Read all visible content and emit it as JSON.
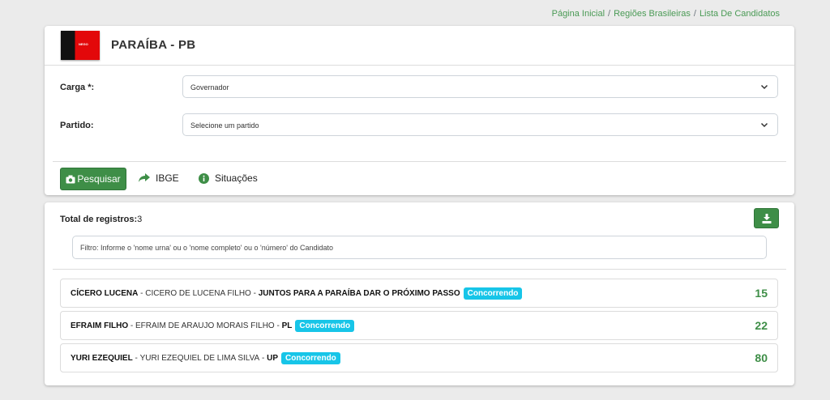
{
  "breadcrumb": {
    "home": "Página Inicial",
    "regions": "Regiões Brasileiras",
    "current": "Lista De Candidatos",
    "separator": "/"
  },
  "state": {
    "title": "PARAÍBA - PB",
    "flag_text": "NEGO"
  },
  "form": {
    "cargo": {
      "label": "Carga *:",
      "value": "Governador"
    },
    "partido": {
      "label": "Partido:",
      "value": "Selecione um partido"
    }
  },
  "actions": {
    "search": "Pesquisar",
    "ibge": "IBGE",
    "situacoes": "Situações"
  },
  "results": {
    "total_label": "Total de registros:",
    "total_value": "3",
    "filter_value": "Filtro: Informe o 'nome urna' ou o 'nome completo' ou o 'número' do Candidato"
  },
  "candidates": [
    {
      "urn_name": "CÍCERO LUCENA",
      "full_name": "CICERO DE LUCENA FILHO",
      "party": "JUNTOS PARA A PARAÍBA DAR O PRÓXIMO PASSO",
      "status": "Concorrendo",
      "number": "15"
    },
    {
      "urn_name": "EFRAIM FILHO",
      "full_name": "EFRAIM DE ARAUJO MORAIS FILHO",
      "party": "PL",
      "status": "Concorrendo",
      "number": "22"
    },
    {
      "urn_name": "YURI EZEQUIEL",
      "full_name": "YURI EZEQUIEL DE LIMA SILVA",
      "party": "UP",
      "status": "Concorrendo",
      "number": "80"
    }
  ],
  "colors": {
    "accent_green": "#3e8e47",
    "badge_cyan": "#17c5e8",
    "background": "#ebebeb"
  }
}
